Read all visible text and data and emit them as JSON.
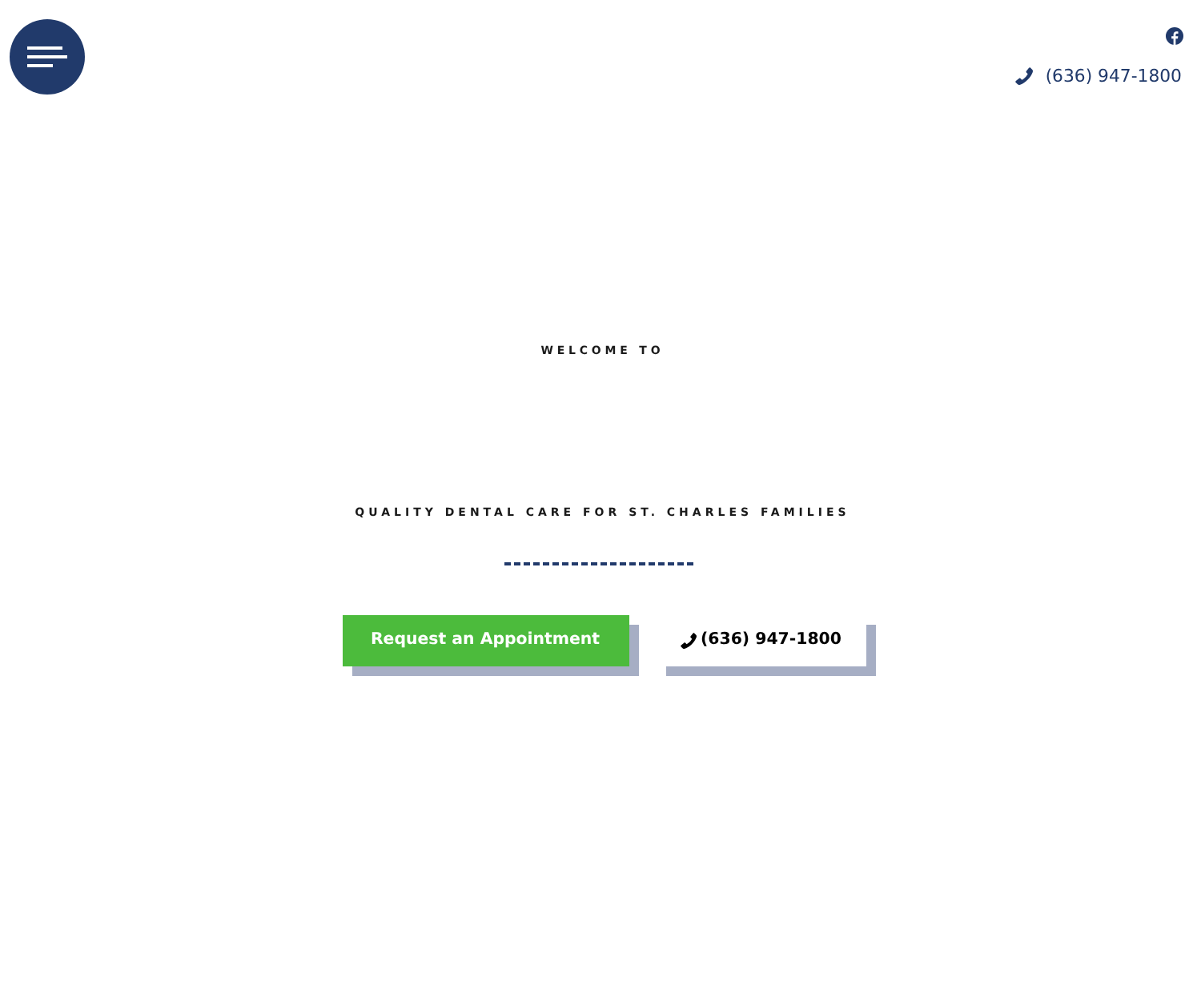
{
  "header": {
    "social": [
      {
        "kind": "facebook"
      }
    ],
    "phone": "(636) 947-1800"
  },
  "hero": {
    "eyebrow": "WELCOME TO",
    "tagline": "QUALITY DENTAL CARE FOR ST. CHARLES FAMILIES",
    "buttons": [
      {
        "kind": "primary",
        "label": "Request an Appointment"
      },
      {
        "kind": "phone",
        "label": "(636) 947-1800"
      }
    ]
  }
}
